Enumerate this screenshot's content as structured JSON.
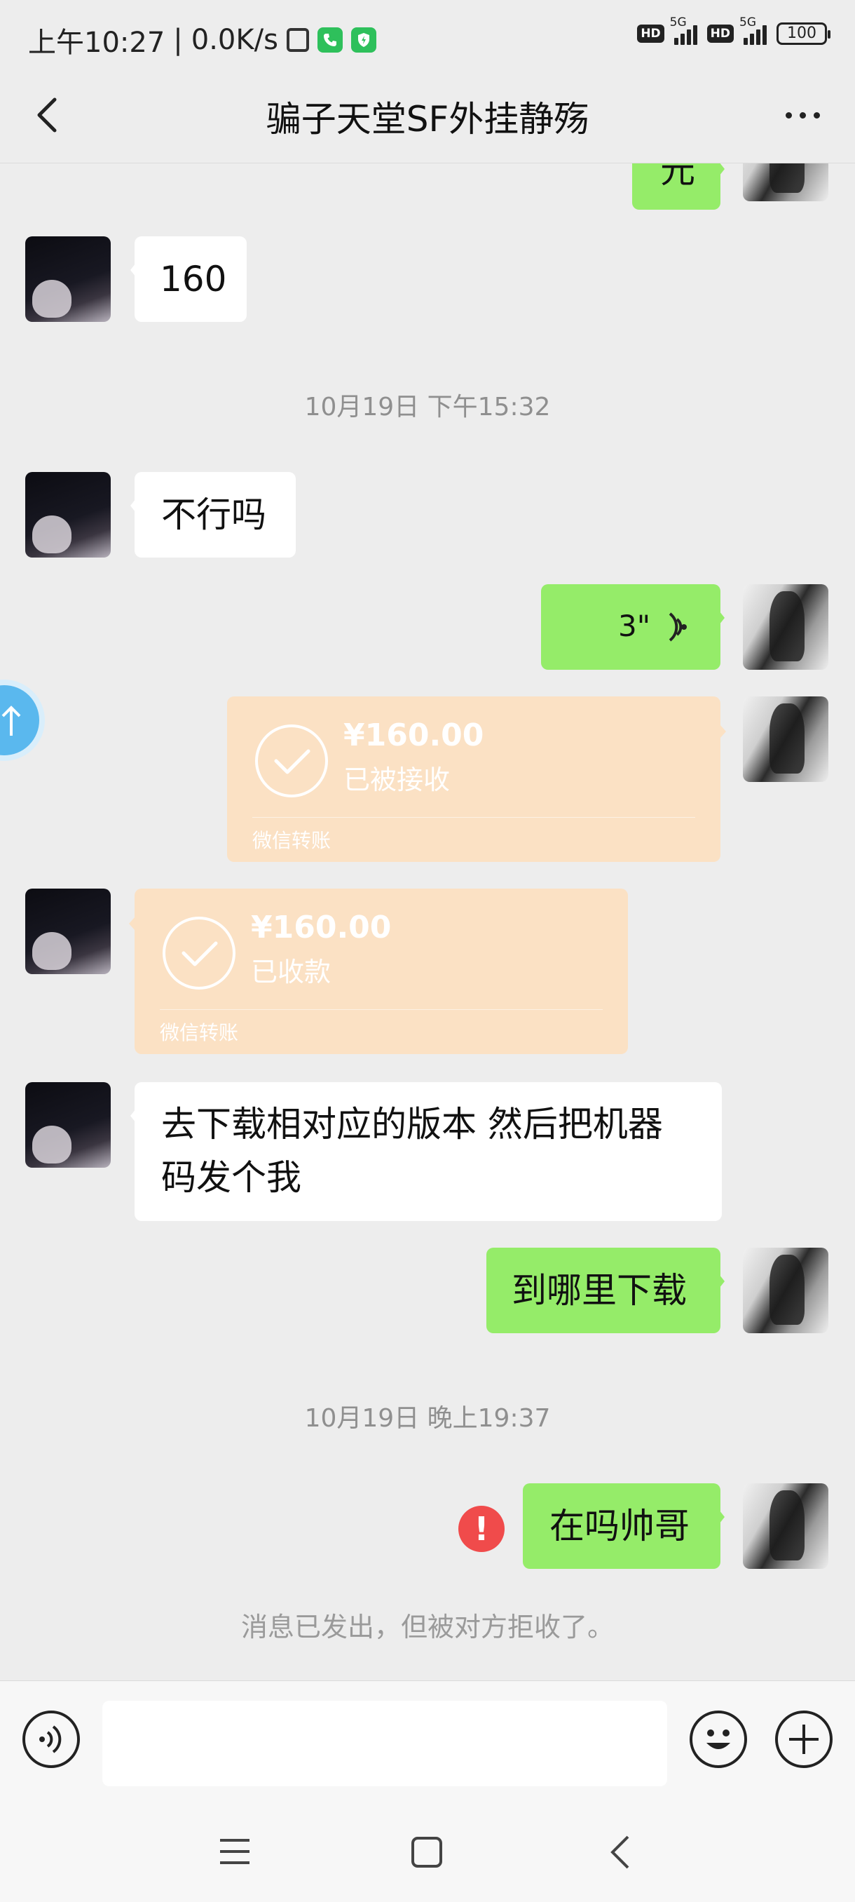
{
  "status_bar": {
    "time": "上午10:27",
    "net_speed": "0.0K/s",
    "hd1": "HD",
    "sig1_label": "5G",
    "hd2": "HD",
    "sig2_label": "5G",
    "battery": "100"
  },
  "header": {
    "title": "骗子天堂SF外挂静殇"
  },
  "messages": {
    "top_partial": "元",
    "m1": "160",
    "time1": "10月19日 下午15:32",
    "m2": "不行吗",
    "voice_duration": "3\"",
    "transfer_sent": {
      "amount": "¥160.00",
      "status": "已被接收",
      "footer": "微信转账"
    },
    "transfer_recv": {
      "amount": "¥160.00",
      "status": "已收款",
      "footer": "微信转账"
    },
    "m3": "去下载相对应的版本 然后把机器码发个我",
    "m4": "到哪里下载",
    "time2": "10月19日 晚上19:37",
    "m5": "在吗帅哥",
    "error_mark": "!",
    "system": "消息已发出，但被对方拒收了。"
  },
  "colors": {
    "background": "#ededed",
    "self_bubble": "#95ec69",
    "other_bubble": "#ffffff",
    "transfer_card": "#fbe1c4",
    "error": "#f04b4b"
  }
}
